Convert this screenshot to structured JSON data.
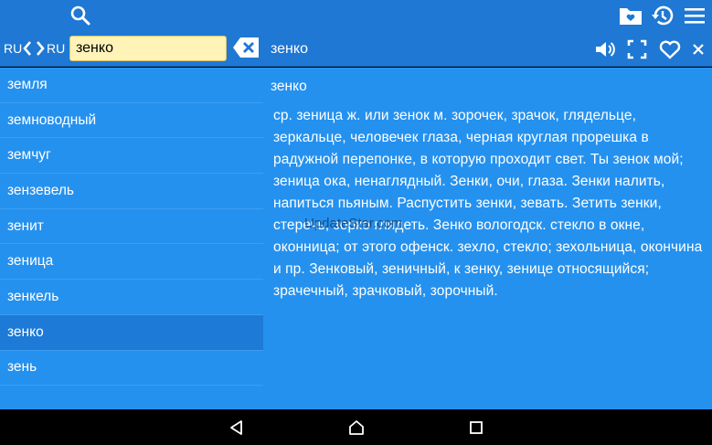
{
  "toolbar": {
    "icons": [
      "search-icon",
      "saved-folder-icon",
      "history-icon",
      "menu-icon"
    ]
  },
  "search": {
    "source_lang": "RU",
    "target_lang": "RU",
    "query": "зенко"
  },
  "article_header": {
    "title": "зенко",
    "icons": [
      "speaker-icon",
      "fullscreen-icon",
      "favorite-icon",
      "close-icon"
    ]
  },
  "word_list": [
    {
      "text": "земля"
    },
    {
      "text": "земноводный"
    },
    {
      "text": "земчуг"
    },
    {
      "text": "зензевель"
    },
    {
      "text": "зенит"
    },
    {
      "text": "зеница"
    },
    {
      "text": "зенкель"
    },
    {
      "text": "зенко"
    },
    {
      "text": "зень"
    }
  ],
  "article": {
    "headword": "зенко",
    "definition": "ср. зеница ж. или зенок м. зорочек, зрачок, глядельце, зеркальце, человечек глаза, черная круглая прорешка в радужной перепонке, в которую проходит свет. Ты зенок мой; зеница ока, ненаглядный. Зенки, очи, глаза. Зенки налить, напиться пьяным. Распустить зенки, зевать. Зетить зенки, стеречь, зорко глядеть. Зенко вологодск. стекло в окне, оконница; от этого офенск. зехло, стекло; зехольница, окончина и пр. Зенковый, зеничный, к зенку, зенице относящийся; зрачечный, зрачковый, зорочный.",
    "watermark": "UpdateStar.com"
  },
  "system_nav": {
    "icons": [
      "back-icon",
      "home-icon",
      "recents-icon"
    ]
  },
  "colors": {
    "bar": "#1e78d4",
    "panel": "#2591ef",
    "selected_row": "#1d7ad6",
    "input_bg": "#fff3b8"
  }
}
